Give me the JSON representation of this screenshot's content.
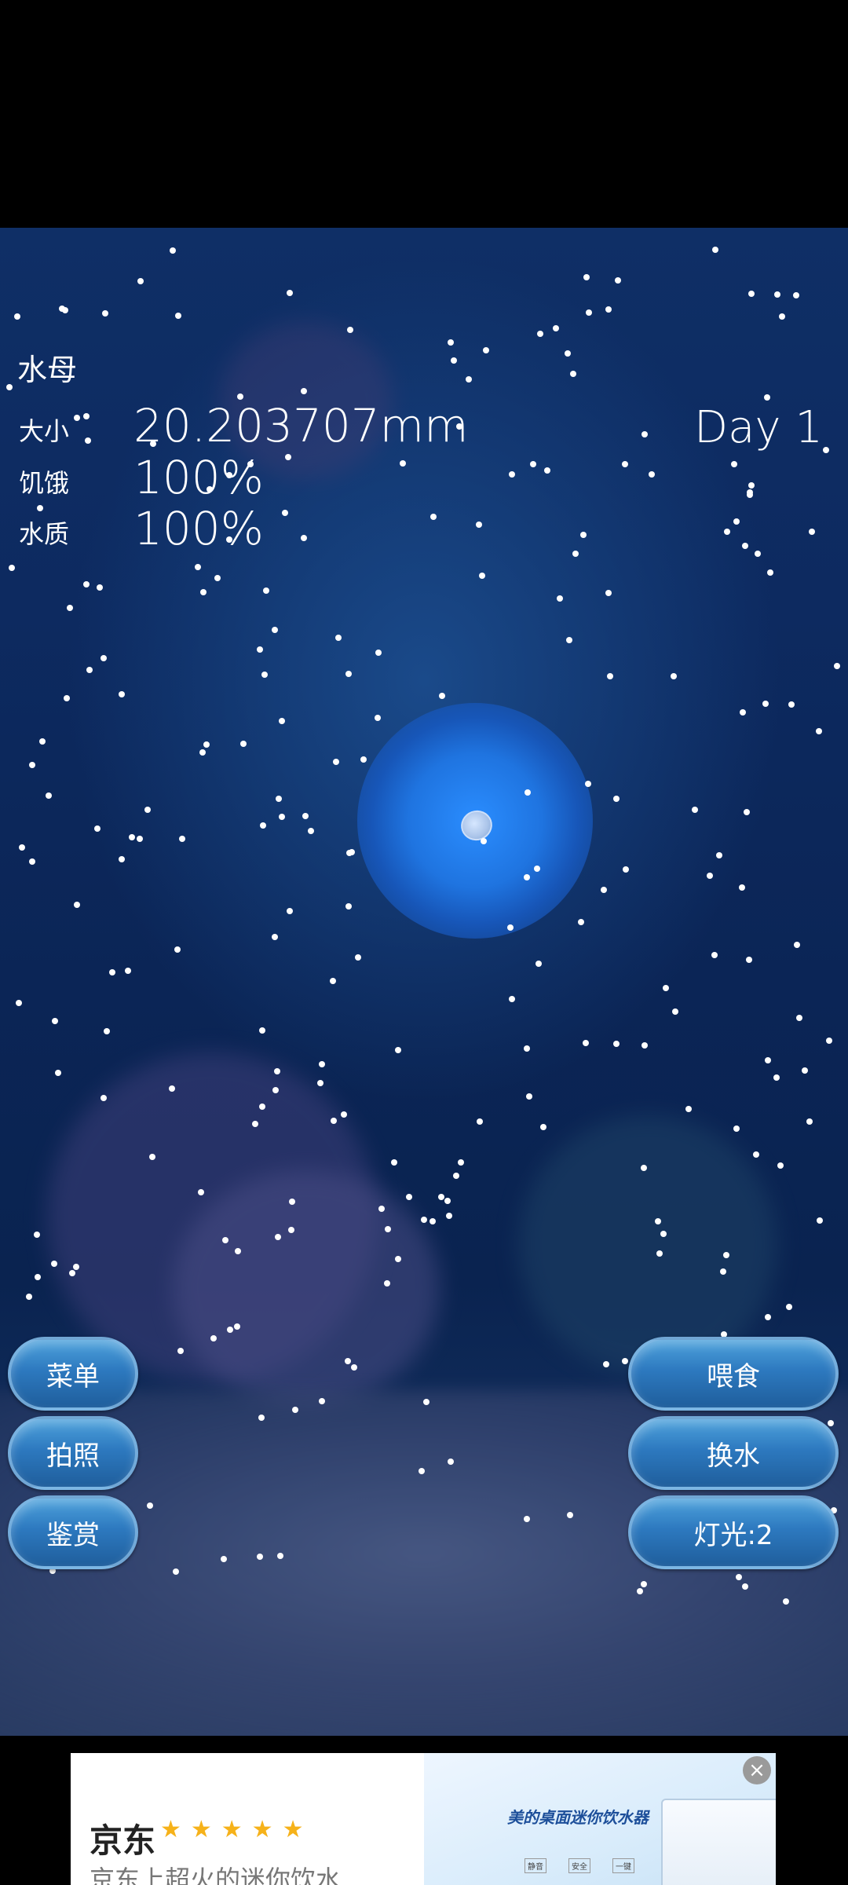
{
  "hud": {
    "title": "水母",
    "size_label": "大小",
    "size_value": "20.203707mm",
    "hunger_label": "饥饿",
    "hunger_value": "100%",
    "water_label": "水质",
    "water_value": "100%",
    "day": "Day 1"
  },
  "buttons": {
    "menu": "菜单",
    "photo": "拍照",
    "appreciate": "鉴赏",
    "feed": "喂食",
    "change_water": "换水",
    "light": "灯光:2"
  },
  "ad": {
    "brand": "京东",
    "rating_stars": 5,
    "stars": "★★★★★",
    "text": "京东上超火的迷你饮水...",
    "headline": "美的桌面迷你饮水器",
    "features": [
      "静音",
      "安全",
      "一键"
    ],
    "close_icon": "close-icon"
  },
  "colors": {
    "water": "#0b2556",
    "glow": "#2a8dff",
    "button": "#2d79bf",
    "star": "#f6b21a"
  }
}
